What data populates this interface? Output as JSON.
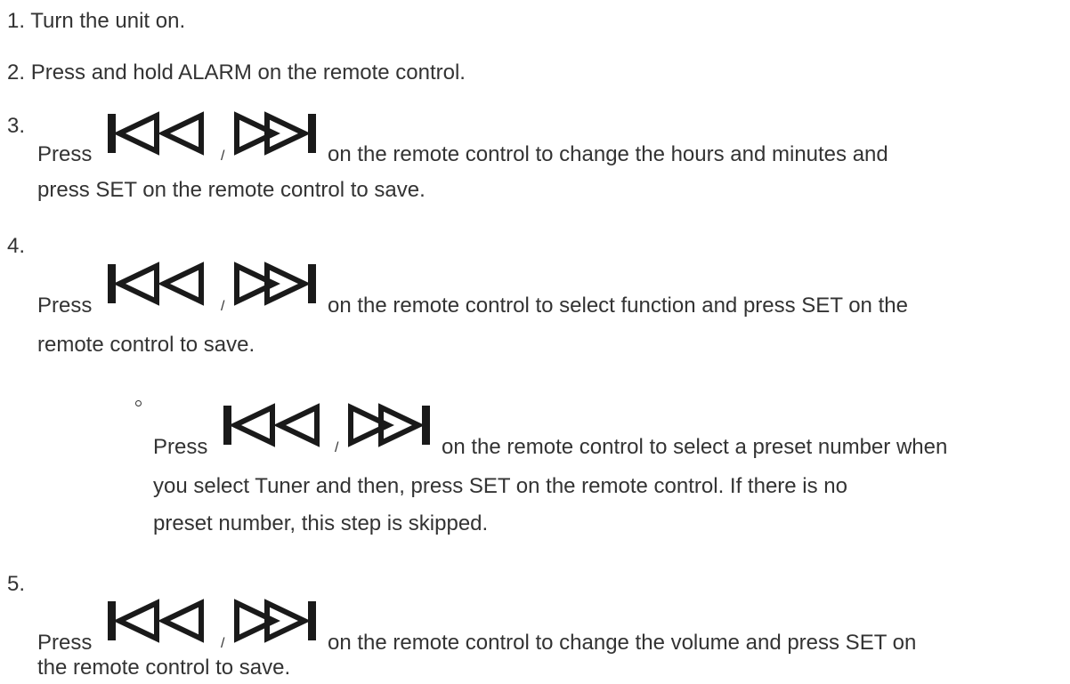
{
  "steps": [
    {
      "num": "1.",
      "text": "Turn the unit on."
    },
    {
      "num": "2.",
      "text": "Press and hold ALARM on the remote control."
    },
    {
      "num": "3.",
      "lead": "Press",
      "sep": "/",
      "line1": "on the remote control to change the hours and minutes and",
      "line2": "press SET on the remote control to save."
    },
    {
      "num": "4.",
      "lead": "Press",
      "sep": "/",
      "line1": "on the remote control to select function and press SET on the",
      "line2": "remote control to save."
    },
    {
      "lead": "Press",
      "sep": "/",
      "line1": "on the remote control to select a preset number when",
      "line2": "you select Tuner and then, press SET on the remote control. If there is no",
      "line3": "preset number, this step is skipped."
    },
    {
      "num": "5.",
      "lead": "Press",
      "sep": "/",
      "line1": "on the remote control to change the volume and press SET on",
      "line2": "the remote control to save."
    }
  ],
  "icons": {
    "prev": "skip-back-icon",
    "next": "skip-forward-icon"
  }
}
